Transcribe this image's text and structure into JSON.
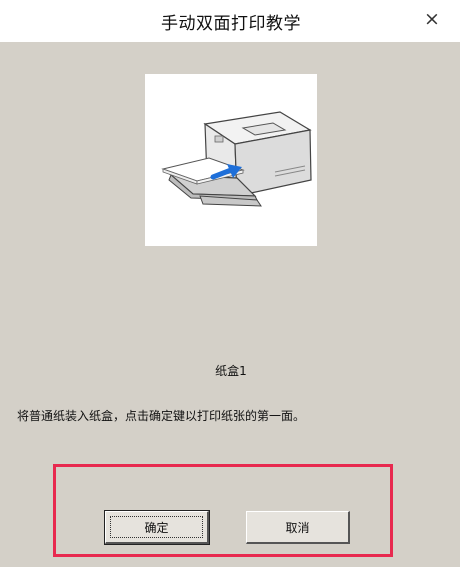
{
  "dialog": {
    "title": "手动双面打印教学",
    "close_symbol": "×",
    "tray_label": "纸盒1",
    "instruction": "将普通纸装入纸盒，点击确定键以打印纸张的第一面。",
    "ok_label": "确定",
    "cancel_label": "取消",
    "illustration_icon": "printer-paper-loading-icon",
    "highlight_color": "#e8294f"
  }
}
